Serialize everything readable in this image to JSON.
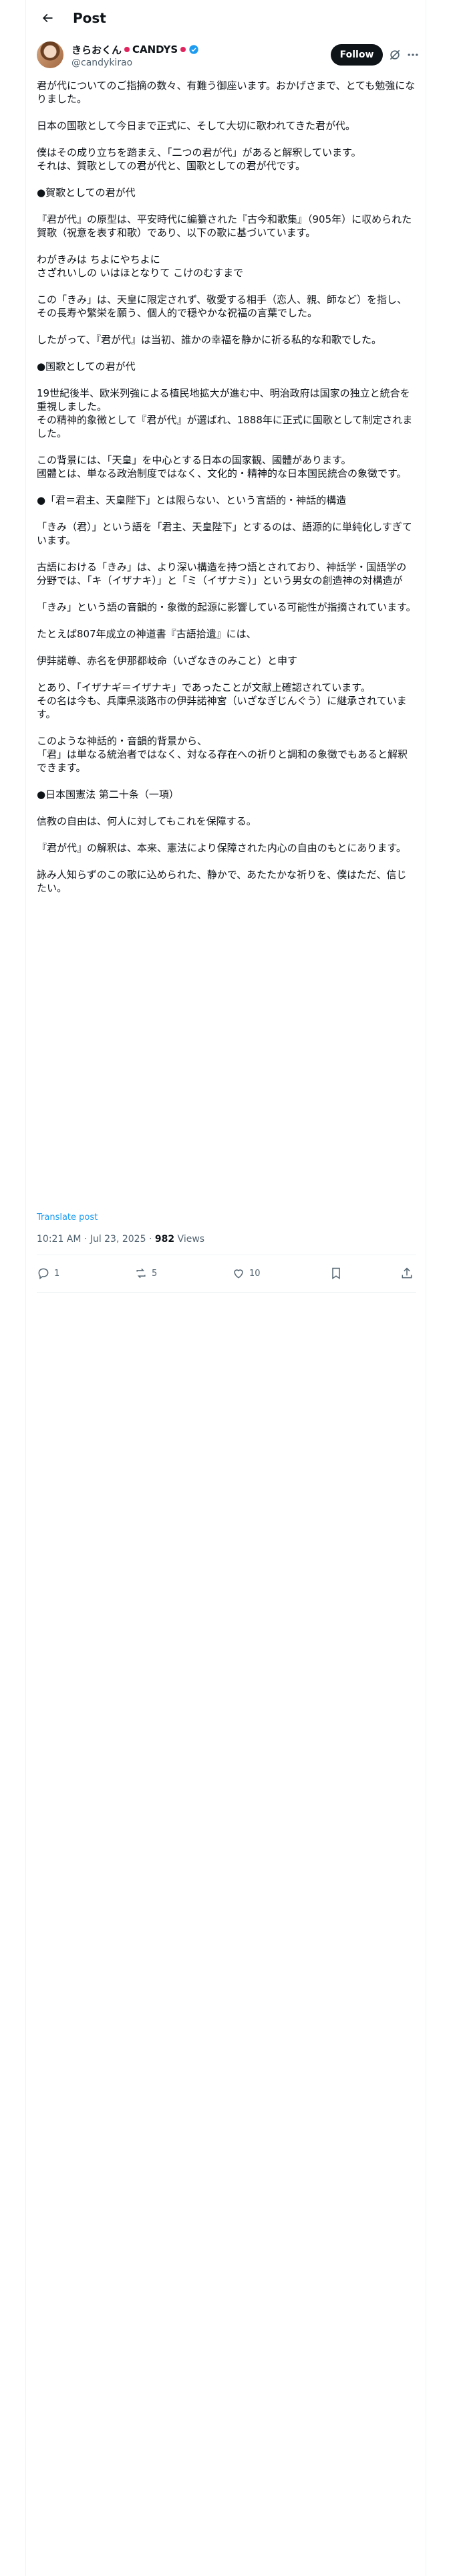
{
  "header": {
    "title": "Post"
  },
  "author": {
    "display_name": "きらおくん",
    "brand": "CANDYS",
    "handle": "@candykirao",
    "follow_label": "Follow"
  },
  "paragraphs": [
    "君が代についてのご指摘の数々、有難う御座います。おかげさまで、とても勉強になりました。",
    "日本の国歌として今日まで正式に、そして大切に歌われてきた君が代。",
    "僕はその成り立ちを踏まえ、「二つの君が代」があると解釈しています。\nそれは、賀歌としての君が代と、国歌としての君が代です。",
    "●賀歌としての君が代",
    "『君が代』の原型は、平安時代に編纂された『古今和歌集』（905年）に収められた賀歌（祝意を表す和歌）であり、以下の歌に基づいています。",
    "わがきみは ちよにやちよに\nさざれいしの いはほとなりて こけのむすまで",
    "この「きみ」は、天皇に限定されず、敬愛する相手（恋人、親、師など）を指し、\nその長寿や繁栄を願う、個人的で穏やかな祝福の言葉でした。",
    "したがって、『君が代』は当初、誰かの幸福を静かに祈る私的な和歌でした。",
    "●国歌としての君が代",
    "19世紀後半、欧米列強による植民地拡大が進む中、明治政府は国家の独立と統合を重視しました。\nその精神的象徴として『君が代』が選ばれ、1888年に正式に国歌として制定されました。",
    "この背景には、「天皇」を中心とする日本の国家観、國體があります。\n國體とは、単なる政治制度ではなく、文化的・精神的な日本国民統合の象徴です。",
    "●「君＝君主、天皇陛下」とは限らない、という言語的・神話的構造",
    "「きみ（君）」という語を「君主、天皇陛下」とするのは、語源的に単純化しすぎています。",
    "古語における「きみ」は、より深い構造を持つ語とされており、神話学・国語学の分野では、「キ（イザナキ）」と「ミ（イザナミ）」という男女の創造神の対構造が",
    "「きみ」という語の音韻的・象徴的起源に影響している可能性が指摘されています。",
    "たとえば807年成立の神道書『古語拾遺』には、",
    "伊弉諾尊、赤名を伊那都岐命（いざなきのみこと）と申す",
    "とあり、「イザナギ＝イザナキ」であったことが文献上確認されています。\nその名は今も、兵庫県淡路市の伊弉諾神宮（いざなぎじんぐう）に継承されています。",
    "このような神話的・音韻的背景から、\n「君」は単なる統治者ではなく、対なる存在への祈りと調和の象徴でもあると解釈できます。",
    "●日本国憲法 第二十条（一項）",
    "信教の自由は、何人に対してもこれを保障する。",
    "『君が代』の解釈は、本来、憲法により保障された内心の自由のもとにあります。",
    "詠み人知らずのこの歌に込められた、静かで、あたたかな祈りを、僕はただ、信じたい。"
  ],
  "translate_label": "Translate post",
  "meta": {
    "time": "10:21 AM",
    "date": "Jul 23, 2025",
    "views_count": "982",
    "views_label": "Views"
  },
  "actions": {
    "replies": "1",
    "reposts": "5",
    "likes": "10"
  },
  "colors": {
    "accent": "#1d9bf0",
    "text": "#0f1419",
    "muted": "#536471",
    "border": "#eff3f4"
  },
  "icons": [
    "back-arrow-icon",
    "verified-badge-icon",
    "grok-icon",
    "more-icon",
    "reply-icon",
    "repost-icon",
    "like-icon",
    "bookmark-icon",
    "share-icon"
  ]
}
